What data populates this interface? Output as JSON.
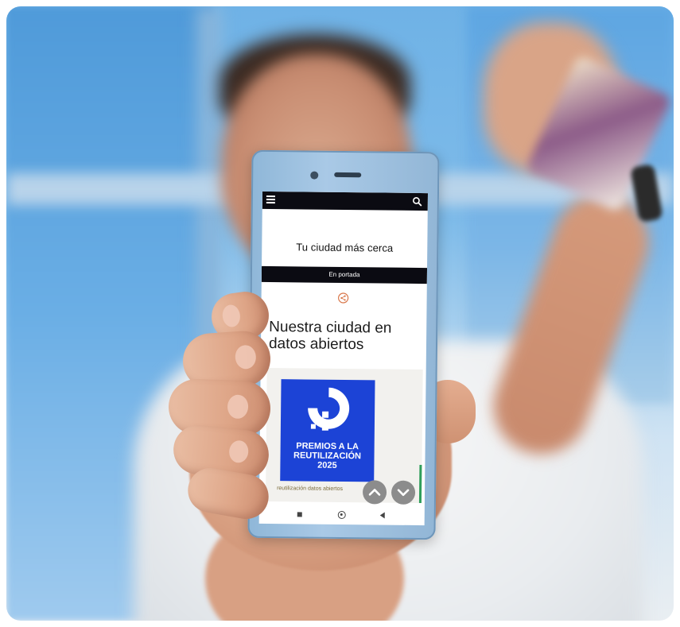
{
  "site": {
    "title": "Tu ciudad más cerca",
    "section_label": "En portada"
  },
  "article": {
    "headline": "Nuestra ciudad en datos abiertos",
    "image_caption": "reutilización datos abiertos",
    "award": {
      "line1": "PREMIOS A LA",
      "line2": "REUTILIZACIÓN",
      "year": "2025"
    }
  },
  "icons": {
    "menu": "hamburger-menu-icon",
    "search": "search-icon",
    "share": "share-icon",
    "scroll_up": "chevron-up-icon",
    "scroll_down": "chevron-down-icon"
  },
  "colors": {
    "topbar": "#0b0b12",
    "award_blue": "#1c43d6",
    "nav_button": "#8c8c8c"
  }
}
